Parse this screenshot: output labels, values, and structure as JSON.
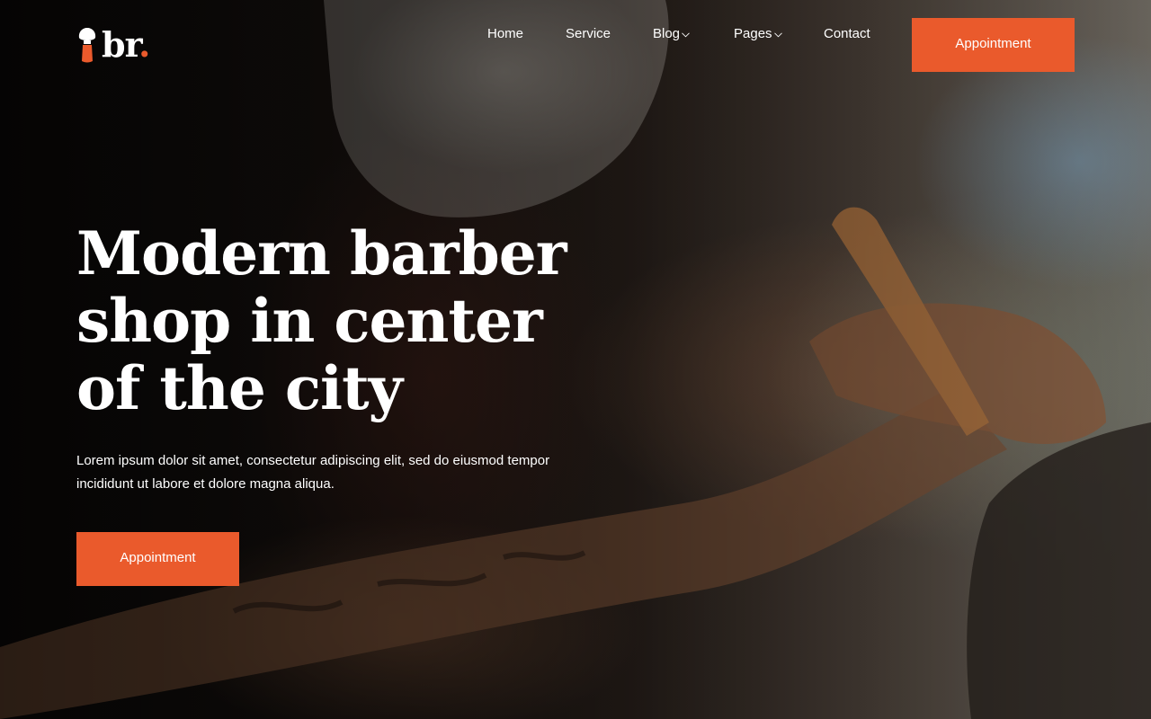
{
  "brand": {
    "logo_text": "br",
    "logo_dot": ".",
    "accent_color": "#ea5a2c"
  },
  "nav": {
    "items": [
      {
        "label": "Home",
        "has_dropdown": false
      },
      {
        "label": "Service",
        "has_dropdown": false
      },
      {
        "label": "Blog",
        "has_dropdown": true
      },
      {
        "label": "Pages",
        "has_dropdown": true
      },
      {
        "label": "Contact",
        "has_dropdown": false
      }
    ],
    "cta_label": "Appointment"
  },
  "hero": {
    "title_lines": [
      "Modern barber",
      "shop in center",
      "of the city"
    ],
    "description": "Lorem ipsum dolor sit amet, consectetur adipiscing elit, sed do eiusmod tempor incididunt ut labore et dolore magna aliqua.",
    "cta_label": "Appointment",
    "background_image": "barber-shaving-client-photo"
  },
  "icons": {
    "logo": "shaving-brush-icon",
    "dropdown": "chevron-down-icon"
  }
}
